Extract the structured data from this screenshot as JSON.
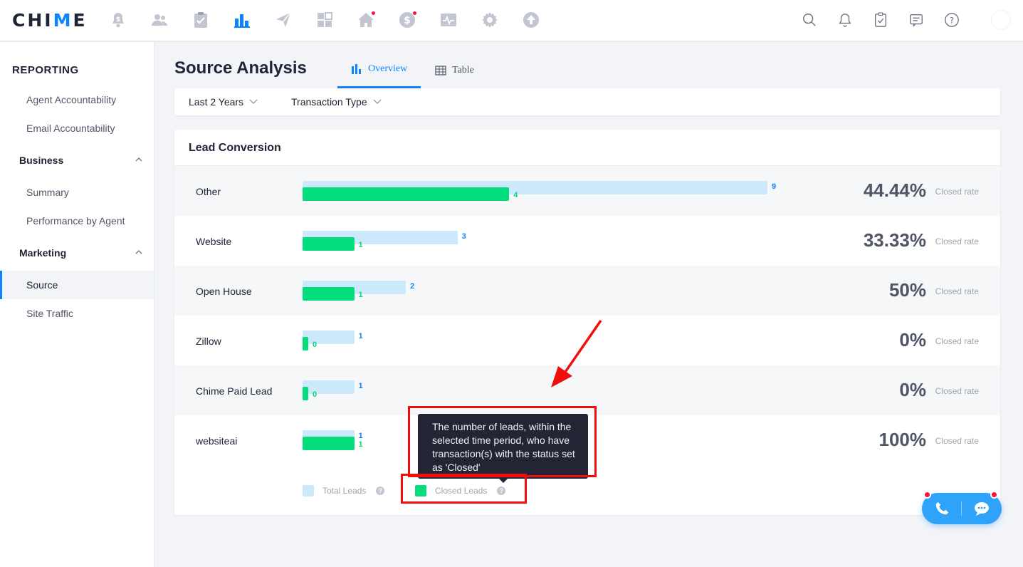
{
  "app": {
    "logo_pre": "CHI",
    "logo_accent": "M",
    "logo_post": "E"
  },
  "top_nav": [
    {
      "name": "leads-icon",
      "dot": false
    },
    {
      "name": "people-icon",
      "dot": false
    },
    {
      "name": "tasks-icon",
      "dot": false
    },
    {
      "name": "reporting-icon",
      "dot": false,
      "active": true
    },
    {
      "name": "marketing-icon",
      "dot": false
    },
    {
      "name": "site-builder-icon",
      "dot": false
    },
    {
      "name": "listings-icon",
      "dot": true
    },
    {
      "name": "transactions-icon",
      "dot": true
    },
    {
      "name": "analytics-icon",
      "dot": false
    },
    {
      "name": "settings-icon",
      "dot": false
    },
    {
      "name": "upgrade-icon",
      "dot": false
    }
  ],
  "sidebar": {
    "title": "REPORTING",
    "items": [
      {
        "label": "Agent Accountability"
      },
      {
        "label": "Email Accountability"
      }
    ],
    "groups": [
      {
        "label": "Business",
        "items": [
          {
            "label": "Summary"
          },
          {
            "label": "Performance by Agent"
          }
        ]
      },
      {
        "label": "Marketing",
        "items": [
          {
            "label": "Source",
            "active": true
          },
          {
            "label": "Site Traffic"
          }
        ]
      }
    ]
  },
  "page": {
    "title": "Source Analysis",
    "tabs": [
      {
        "label": "Overview",
        "active": true
      },
      {
        "label": "Table",
        "active": false
      }
    ],
    "filters": [
      {
        "label": "Last 2 Years"
      },
      {
        "label": "Transaction Type"
      }
    ]
  },
  "card": {
    "title": "Lead Conversion",
    "rate_label": "Closed rate",
    "rows": [
      {
        "source": "Other",
        "total": 9,
        "closed": 4,
        "rate": "44.44%"
      },
      {
        "source": "Website",
        "total": 3,
        "closed": 1,
        "rate": "33.33%"
      },
      {
        "source": "Open House",
        "total": 2,
        "closed": 1,
        "rate": "50%"
      },
      {
        "source": "Zillow",
        "total": 1,
        "closed": 0,
        "rate": "0%"
      },
      {
        "source": "Chime Paid Lead",
        "total": 1,
        "closed": 0,
        "rate": "0%"
      },
      {
        "source": "websiteai",
        "total": 1,
        "closed": 1,
        "rate": "100%"
      }
    ],
    "legend": {
      "total_label": "Total Leads",
      "closed_label": "Closed Leads",
      "help_glyph": "?"
    }
  },
  "tooltip": {
    "text": "The number of leads, within the selected time period, who have transaction(s) with the status set as 'Closed'"
  },
  "colors": {
    "accent": "#0d84ff",
    "total_bar": "#cbe9fb",
    "closed_bar": "#03dd7b",
    "annotation": "#f00f0f"
  },
  "chart_data": {
    "type": "bar",
    "title": "Lead Conversion",
    "categories": [
      "Other",
      "Website",
      "Open House",
      "Zillow",
      "Chime Paid Lead",
      "websiteai"
    ],
    "series": [
      {
        "name": "Total Leads",
        "values": [
          9,
          3,
          2,
          1,
          1,
          1
        ]
      },
      {
        "name": "Closed Leads",
        "values": [
          4,
          1,
          1,
          0,
          0,
          1
        ]
      }
    ],
    "legend": "bottom"
  }
}
